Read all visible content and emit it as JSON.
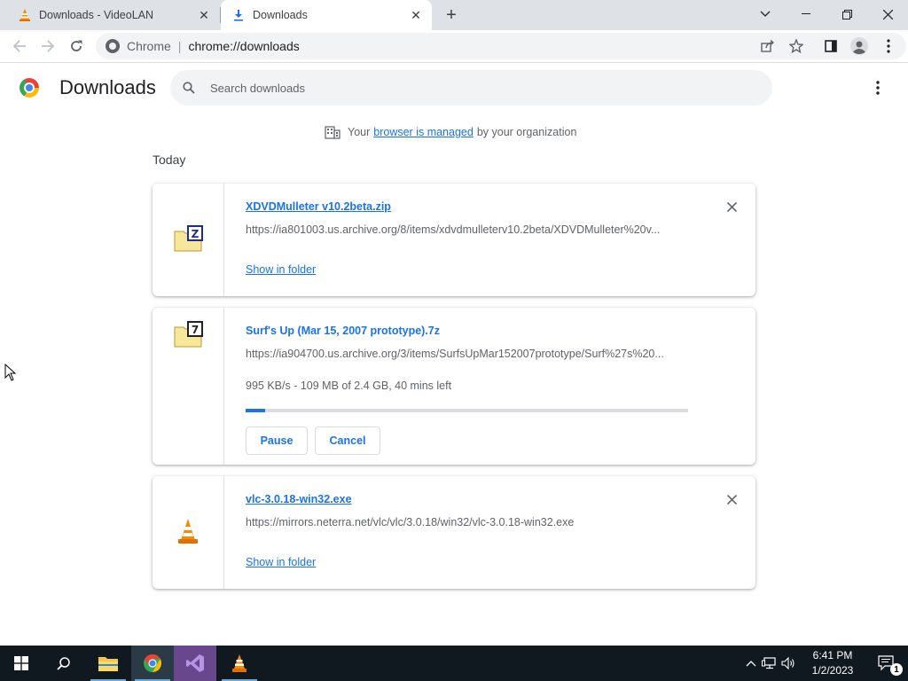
{
  "tabs": [
    {
      "title": "Downloads - VideoLAN",
      "icon": "vlc-cone-icon",
      "active": false
    },
    {
      "title": "Downloads",
      "icon": "download-icon",
      "active": true
    }
  ],
  "window_controls": {
    "tab_search": "⌄",
    "minimize": "—",
    "restore": "❐",
    "close": "✕"
  },
  "toolbar": {
    "chip": "Chrome",
    "url": "chrome://downloads"
  },
  "header": {
    "title": "Downloads",
    "search_placeholder": "Search downloads"
  },
  "managed_notice": {
    "prefix": "Your",
    "link": "browser is managed",
    "suffix": "by your organization"
  },
  "section_label": "Today",
  "downloads": [
    {
      "name": "XDVDMulleter v10.2beta.zip",
      "url": "https://ia801003.us.archive.org/8/items/xdvdmulleterv10.2beta/XDVDMulleter%20v...",
      "action": "Show in folder",
      "icon": "zip-archive-icon",
      "state": "complete"
    },
    {
      "name": "Surf's Up (Mar 15, 2007 prototype).7z",
      "url": "https://ia904700.us.archive.org/3/items/SurfsUpMar152007prototype/Surf%27s%20...",
      "status": "995 KB/s - 109 MB of 2.4 GB, 40 mins left",
      "progress": 0.045,
      "pause_label": "Pause",
      "cancel_label": "Cancel",
      "icon": "7z-archive-icon",
      "state": "in-progress"
    },
    {
      "name": "vlc-3.0.18-win32.exe",
      "url": "https://mirrors.neterra.net/vlc/vlc/3.0.18/win32/vlc-3.0.18-win32.exe",
      "action": "Show in folder",
      "icon": "vlc-cone-icon",
      "state": "complete"
    }
  ],
  "taskbar": {
    "apps": [
      "start-icon",
      "search-icon",
      "file-explorer-icon",
      "chrome-icon",
      "visual-studio-icon",
      "vlc-icon"
    ],
    "time": "6:41 PM",
    "date": "1/2/2023",
    "notification_count": "1"
  },
  "colors": {
    "accent": "#1a73e8",
    "tabstrip": "#dee1e6",
    "taskbar": "#101820"
  }
}
